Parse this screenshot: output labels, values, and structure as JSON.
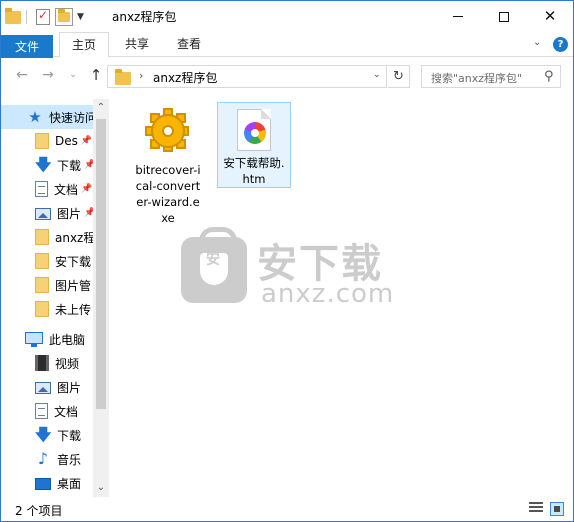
{
  "window": {
    "title": "anxz程序包",
    "controls": {
      "minimize": "minimize-icon",
      "maximize": "maximize-icon",
      "close": "close-icon"
    }
  },
  "ribbon": {
    "tabs": [
      {
        "label": "文件",
        "active": false
      },
      {
        "label": "主页",
        "active": true
      },
      {
        "label": "共享",
        "active": false
      },
      {
        "label": "查看",
        "active": false
      }
    ]
  },
  "address": {
    "path": "anxz程序包",
    "search_placeholder": "搜索\"anxz程序包\""
  },
  "nav": {
    "quick_access": "快速访问",
    "items": [
      {
        "label": "Des",
        "icon": "folder-icon",
        "pinned": true
      },
      {
        "label": "下载",
        "icon": "download-icon",
        "pinned": true
      },
      {
        "label": "文档",
        "icon": "document-icon",
        "pinned": true
      },
      {
        "label": "图片",
        "icon": "picture-icon",
        "pinned": true
      },
      {
        "label": "anxz程",
        "icon": "folder-icon",
        "pinned": false
      },
      {
        "label": "安下载",
        "icon": "folder-icon",
        "pinned": false
      },
      {
        "label": "图片管",
        "icon": "folder-icon",
        "pinned": false
      },
      {
        "label": "未上传",
        "icon": "folder-icon",
        "pinned": false
      }
    ],
    "this_pc": "此电脑",
    "pc_items": [
      {
        "label": "视频",
        "icon": "video-icon"
      },
      {
        "label": "图片",
        "icon": "picture-icon"
      },
      {
        "label": "文档",
        "icon": "document-icon"
      },
      {
        "label": "下载",
        "icon": "download-icon"
      },
      {
        "label": "音乐",
        "icon": "music-icon"
      },
      {
        "label": "桌面",
        "icon": "desktop-icon"
      }
    ]
  },
  "files": [
    {
      "name": "bitrecover-ical-converter-wizard.exe",
      "icon": "gear-exe-icon",
      "selected": false
    },
    {
      "name": "安下载帮助.htm",
      "icon": "htm-file-icon",
      "selected": true
    }
  ],
  "watermark": {
    "cn": "安下载",
    "en": "anxz.com",
    "badge": "安"
  },
  "status": {
    "count": "2 个项目"
  },
  "colors": {
    "accent": "#1979ca",
    "selection": "#cce8ff",
    "folder": "#f0c34f"
  }
}
